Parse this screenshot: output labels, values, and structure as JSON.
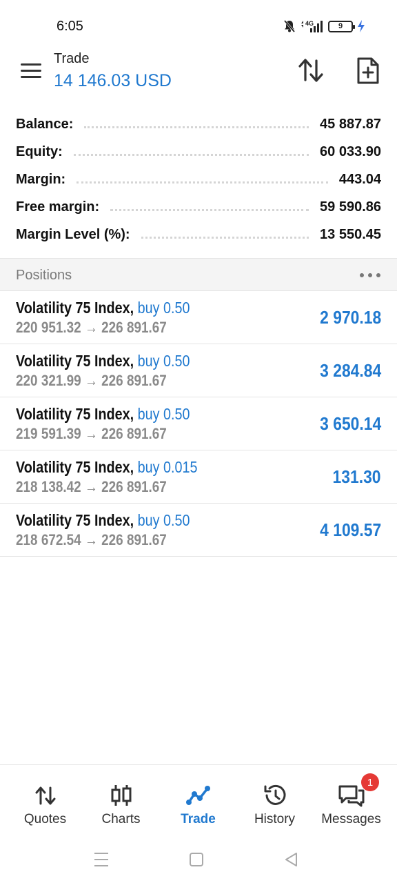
{
  "status_bar": {
    "time": "6:05",
    "network": "4G",
    "battery": "9"
  },
  "header": {
    "title": "Trade",
    "balance": "14 146.03 USD"
  },
  "summary": [
    {
      "label": "Balance:",
      "value": "45 887.87"
    },
    {
      "label": "Equity:",
      "value": "60 033.90"
    },
    {
      "label": "Margin:",
      "value": "443.04"
    },
    {
      "label": "Free margin:",
      "value": "59 590.86"
    },
    {
      "label": "Margin Level (%):",
      "value": "13 550.45"
    }
  ],
  "positions_section": {
    "title": "Positions"
  },
  "positions": [
    {
      "symbol": "Volatility 75 Index,",
      "type": "buy 0.50",
      "prices": "220 951.32 → 226 891.67",
      "profit": "2 970.18"
    },
    {
      "symbol": "Volatility 75 Index,",
      "type": "buy 0.50",
      "prices": "220 321.99 → 226 891.67",
      "profit": "3 284.84"
    },
    {
      "symbol": "Volatility 75 Index,",
      "type": "buy 0.50",
      "prices": "219 591.39 → 226 891.67",
      "profit": "3 650.14"
    },
    {
      "symbol": "Volatility 75 Index,",
      "type": "buy 0.015",
      "prices": "218 138.42 → 226 891.67",
      "profit": "131.30"
    },
    {
      "symbol": "Volatility 75 Index,",
      "type": "buy 0.50",
      "prices": "218 672.54 → 226 891.67",
      "profit": "4 109.57"
    }
  ],
  "bottom_nav": {
    "items": [
      {
        "label": "Quotes",
        "icon": "quotes-icon"
      },
      {
        "label": "Charts",
        "icon": "charts-icon"
      },
      {
        "label": "Trade",
        "icon": "trade-icon",
        "active": true
      },
      {
        "label": "History",
        "icon": "history-icon"
      },
      {
        "label": "Messages",
        "icon": "messages-icon",
        "badge": "1"
      }
    ]
  },
  "colors": {
    "accent": "#2079cf",
    "badge": "#e53935",
    "muted_text": "#8a8a8a",
    "section_bg": "#f4f4f4"
  }
}
